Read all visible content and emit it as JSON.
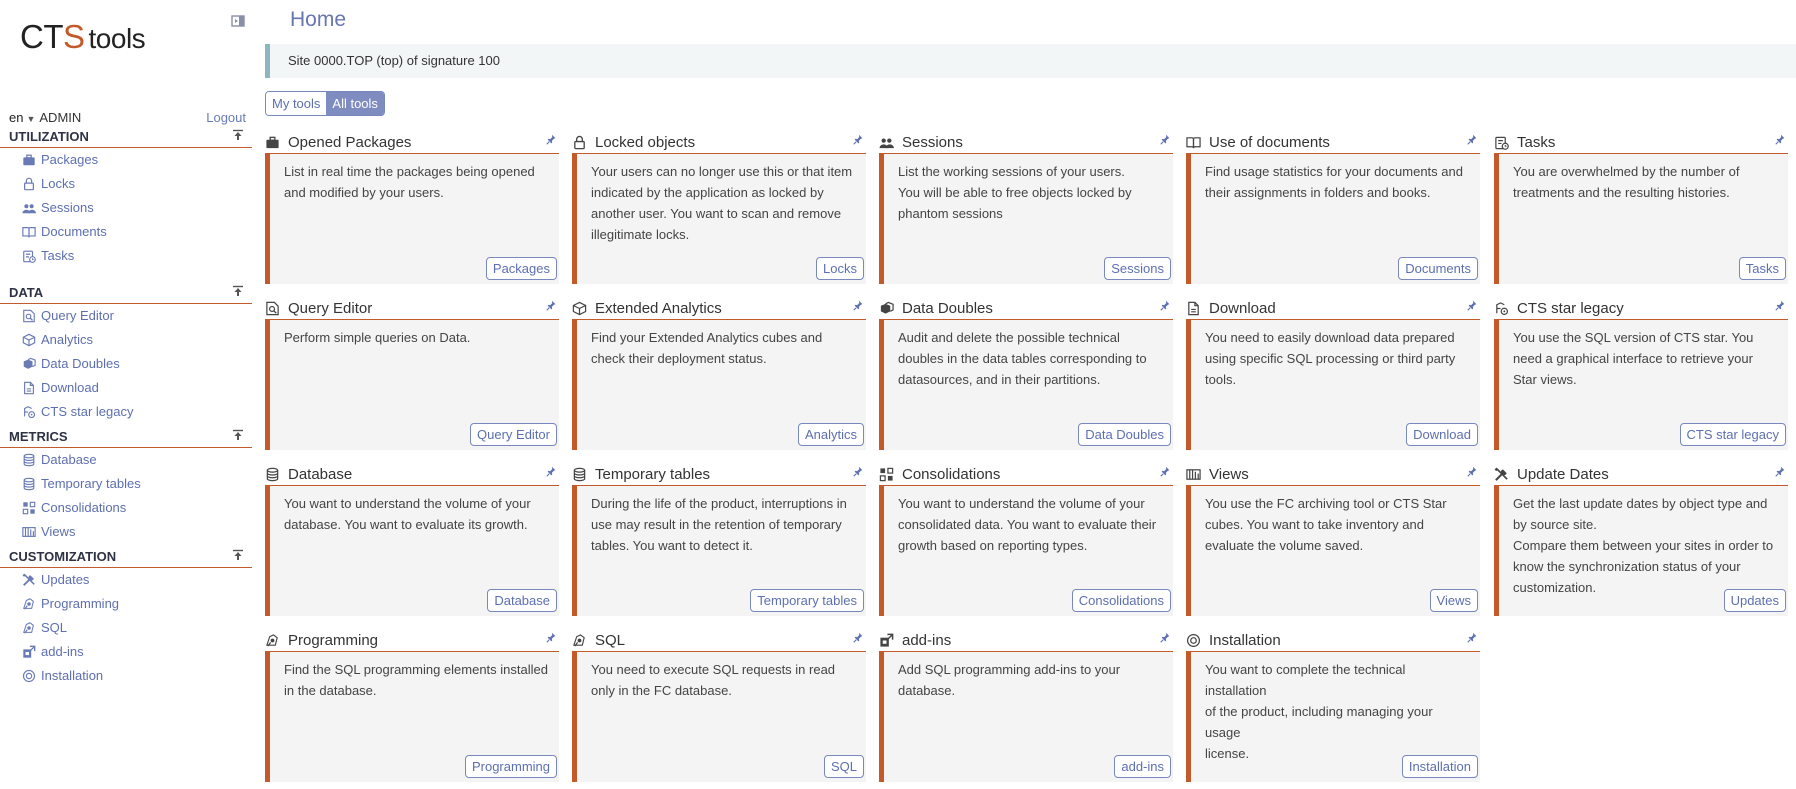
{
  "logo": {
    "c": "C",
    "t": "T",
    "s": "S",
    "tools": "tools"
  },
  "user": {
    "lang": "en",
    "name": "ADMIN",
    "logout": "Logout"
  },
  "sidebar": [
    {
      "title": "UTILIZATION",
      "items": [
        {
          "label": "Packages",
          "icon": "briefcase-icon"
        },
        {
          "label": "Locks",
          "icon": "lock-icon"
        },
        {
          "label": "Sessions",
          "icon": "users-icon"
        },
        {
          "label": "Documents",
          "icon": "book-icon"
        },
        {
          "label": "Tasks",
          "icon": "tasks-icon"
        }
      ]
    },
    {
      "title": "DATA",
      "items": [
        {
          "label": "Query Editor",
          "icon": "query-icon"
        },
        {
          "label": "Analytics",
          "icon": "cube-icon"
        },
        {
          "label": "Data Doubles",
          "icon": "cubes-icon"
        },
        {
          "label": "Download",
          "icon": "file-icon"
        },
        {
          "label": "CTS star legacy",
          "icon": "legacy-icon"
        }
      ]
    },
    {
      "title": "METRICS",
      "items": [
        {
          "label": "Database",
          "icon": "database-icon"
        },
        {
          "label": "Temporary tables",
          "icon": "database-icon"
        },
        {
          "label": "Consolidations",
          "icon": "consolidation-icon"
        },
        {
          "label": "Views",
          "icon": "archive-icon"
        }
      ]
    },
    {
      "title": "CUSTOMIZATION",
      "items": [
        {
          "label": "Updates",
          "icon": "tools-icon"
        },
        {
          "label": "Programming",
          "icon": "code-icon"
        },
        {
          "label": "SQL",
          "icon": "code-icon"
        },
        {
          "label": "add-ins",
          "icon": "addin-icon"
        },
        {
          "label": "Installation",
          "icon": "install-icon"
        }
      ]
    }
  ],
  "page": {
    "title": "Home",
    "info": "Site 0000.TOP (top) of signature 100",
    "tabs": [
      "My tools",
      "All tools"
    ]
  },
  "cards": [
    {
      "title": "Opened Packages",
      "icon": "briefcase-icon",
      "button": "Packages",
      "lines": [
        "List in real time the packages being opened",
        "and modified by your users."
      ]
    },
    {
      "title": "Locked objects",
      "icon": "lock-icon",
      "button": "Locks",
      "lines": [
        "Your users can no longer use this or that item",
        "indicated by the application as locked by",
        "another user. You want to scan and remove",
        "illegitimate locks."
      ]
    },
    {
      "title": "Sessions",
      "icon": "users-icon",
      "button": "Sessions",
      "lines": [
        "List the working sessions of your users.",
        "You will be able to free objects locked by",
        "phantom sessions"
      ]
    },
    {
      "title": "Use of documents",
      "icon": "book-icon",
      "button": "Documents",
      "lines": [
        "Find usage statistics for your documents and",
        "their assignments in folders and books."
      ]
    },
    {
      "title": "Tasks",
      "icon": "tasks-icon",
      "button": "Tasks",
      "lines": [
        "You are overwhelmed by the number of",
        "treatments and the resulting histories."
      ]
    },
    {
      "title": "Query Editor",
      "icon": "query-icon",
      "button": "Query Editor",
      "lines": [
        "Perform simple queries on Data."
      ]
    },
    {
      "title": "Extended Analytics",
      "icon": "cube-icon",
      "button": "Analytics",
      "lines": [
        "Find your Extended Analytics cubes and",
        "check their deployment status."
      ]
    },
    {
      "title": "Data Doubles",
      "icon": "cubes-icon",
      "button": "Data Doubles",
      "lines": [
        "Audit and delete the possible technical",
        "doubles in the data tables corresponding to",
        "datasources, and in their partitions."
      ]
    },
    {
      "title": "Download",
      "icon": "file-icon",
      "button": "Download",
      "lines": [
        "You need to easily download data prepared",
        "using specific SQL processing or third party",
        "tools."
      ]
    },
    {
      "title": "CTS star legacy",
      "icon": "legacy-icon",
      "button": "CTS star legacy",
      "lines": [
        "You use the SQL version of CTS star. You",
        "need a graphical interface to retrieve your",
        "Star views."
      ]
    },
    {
      "title": "Database",
      "icon": "database-icon",
      "button": "Database",
      "lines": [
        "You want to understand the volume of your",
        "database. You want to evaluate its growth."
      ]
    },
    {
      "title": "Temporary tables",
      "icon": "database-icon",
      "button": "Temporary tables",
      "lines": [
        "During the life of the product, interruptions in",
        "use may result in the retention of temporary",
        "tables. You want to detect it."
      ]
    },
    {
      "title": "Consolidations",
      "icon": "consolidation-icon",
      "button": "Consolidations",
      "lines": [
        "You want to understand the volume of your",
        "consolidated data. You want to evaluate their",
        "growth based on reporting types."
      ]
    },
    {
      "title": "Views",
      "icon": "archive-icon",
      "button": "Views",
      "lines": [
        "You use the FC archiving tool or CTS Star",
        "cubes. You want to take inventory and",
        "evaluate the volume saved."
      ]
    },
    {
      "title": "Update Dates",
      "icon": "tools-icon",
      "button": "Updates",
      "lines": [
        "Get the last update dates by object type and",
        "by source site.",
        "Compare them between your sites in order to",
        "know the synchronization status of your",
        "customization."
      ]
    },
    {
      "title": "Programming",
      "icon": "code-icon",
      "button": "Programming",
      "lines": [
        "Find the SQL programming elements installed",
        "in the database."
      ]
    },
    {
      "title": "SQL",
      "icon": "code-icon",
      "button": "SQL",
      "lines": [
        "You need to execute SQL requests in read",
        "only in the FC database."
      ]
    },
    {
      "title": "add-ins",
      "icon": "addin-icon",
      "button": "add-ins",
      "lines": [
        "Add SQL programming add-ins to your",
        "database."
      ]
    },
    {
      "title": "Installation",
      "icon": "install-icon",
      "button": "Installation",
      "lines": [
        "You want to complete the technical installation",
        "of the product, including managing your usage",
        "license."
      ]
    }
  ]
}
